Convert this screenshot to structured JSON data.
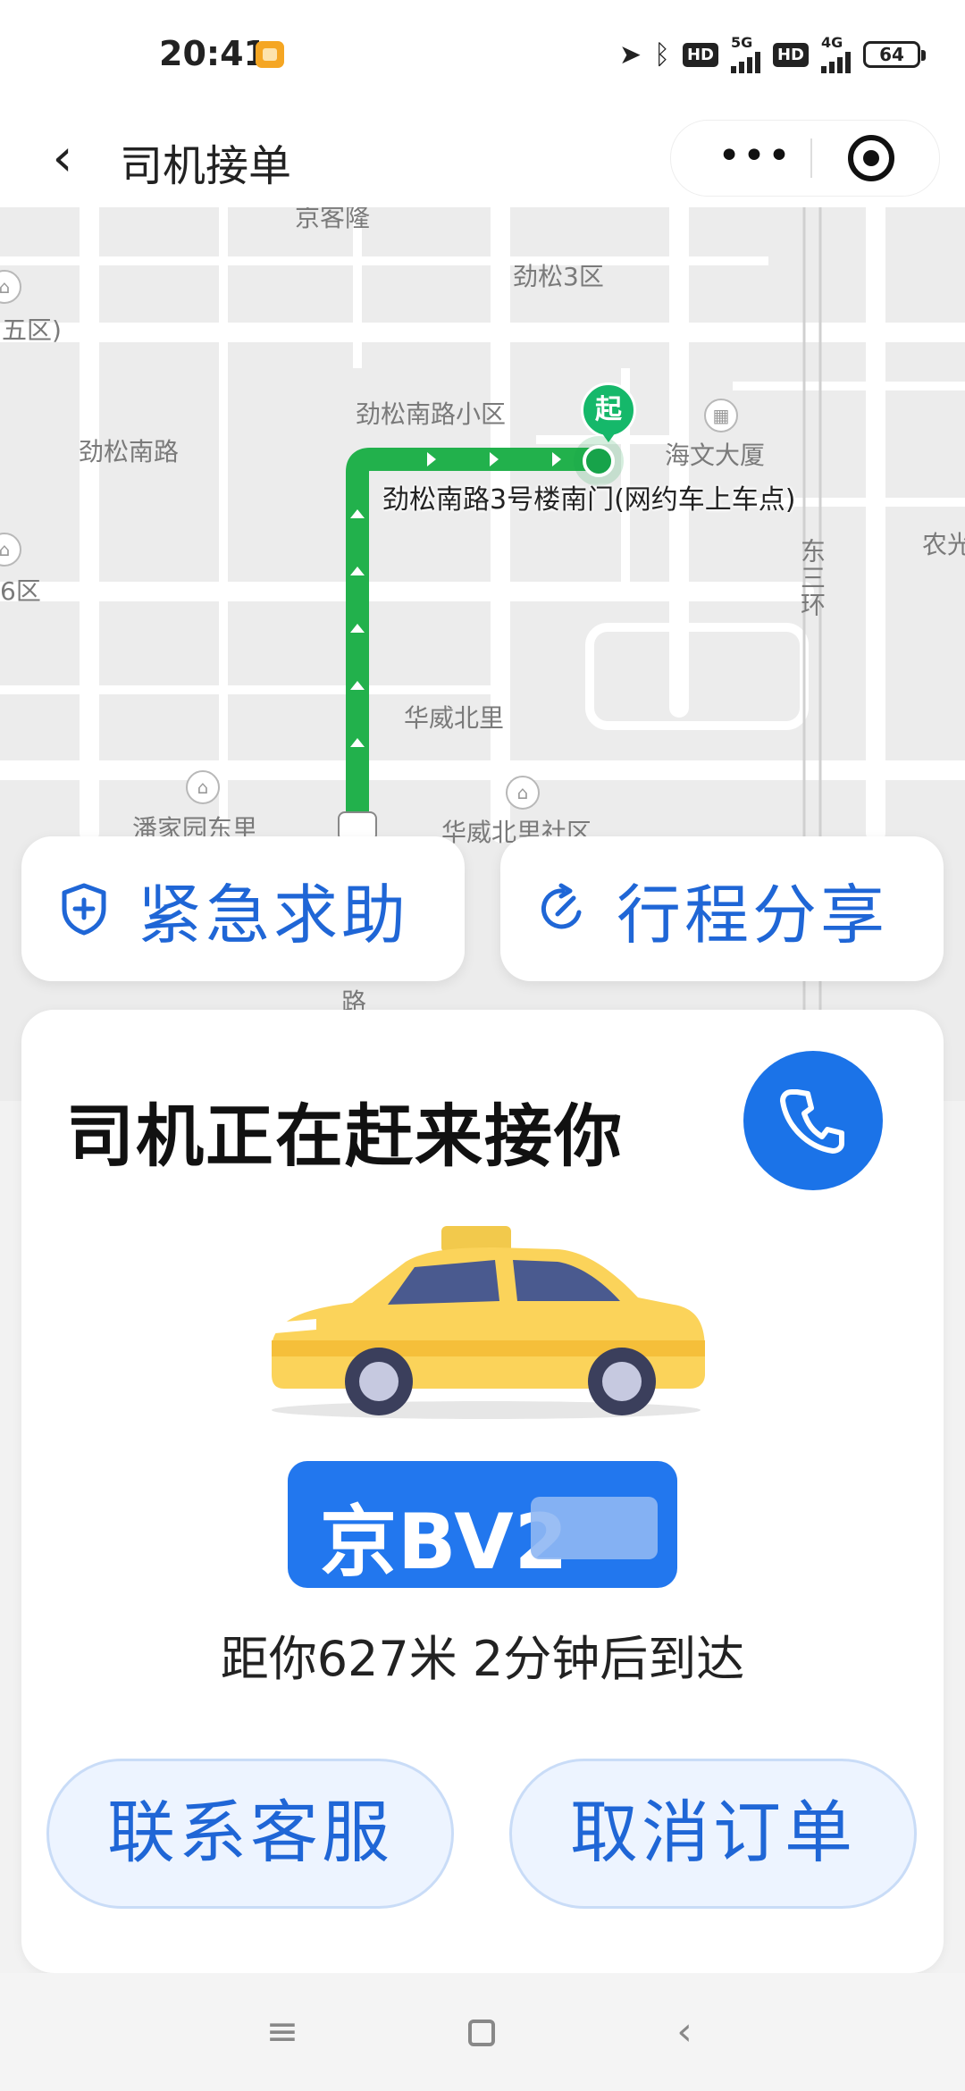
{
  "status_bar": {
    "time": "20:41",
    "network_5g": "5G",
    "network_4g": "4G",
    "hd_label": "HD",
    "battery": "64",
    "icons": [
      "notification-icon",
      "location-arrow-icon",
      "bluetooth-icon",
      "signal-icon"
    ]
  },
  "header": {
    "title": "司机接单",
    "more_label": "•••"
  },
  "map": {
    "labels": [
      "京客隆",
      "劲松3区",
      "五区)",
      "劲松南路小区",
      "劲松南路",
      "海文大厦",
      "农光",
      "6区",
      "华威北里",
      "潘家园东里",
      "华威北里社区",
      "路",
      "东三环"
    ],
    "pickup_point": "劲松南路3号楼南门(网约车上车点)",
    "start_marker": "起",
    "route_color": "#22b14c"
  },
  "actions": {
    "sos_label": "紧急求助",
    "share_label": "行程分享"
  },
  "driver_card": {
    "title": "司机正在赶来接你",
    "plate": "京BV2",
    "eta_text": "距你627米 2分钟后到达",
    "support_label": "联系客服",
    "cancel_label": "取消订单"
  },
  "colors": {
    "accent": "#1f66d6",
    "call_button": "#1b73e8",
    "plate_bg": "#2277ee",
    "pill_bg": "#edf4ff"
  }
}
